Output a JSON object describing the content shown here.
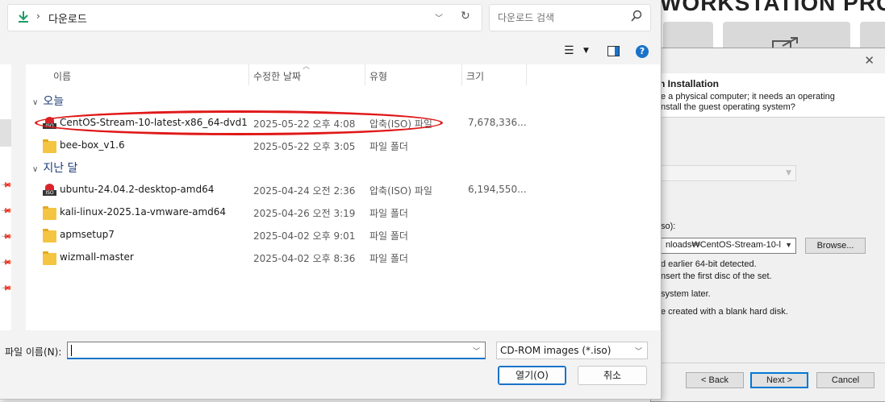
{
  "background_app": {
    "title": "WORKSTATION PRO",
    "wizard": {
      "header_title": "n Installation",
      "header_desc": "e a physical computer; it needs an operating\nnstall the guest operating system?",
      "iso_label": "so):",
      "iso_path": "nloads₩CentOS-Stream-10-l",
      "browse_label": "Browse...",
      "detected_line1": "d earlier 64-bit detected.",
      "detected_line2": "nsert the first disc of the set.",
      "later_line": "system later.",
      "blank_line": "e created with a blank hard disk.",
      "back_label": "< Back",
      "next_label": "Next >",
      "cancel_label": "Cancel"
    }
  },
  "dialog": {
    "breadcrumb": "다운로드",
    "search_placeholder": "다운로드 검색",
    "columns": {
      "name": "이름",
      "date": "수정한 날짜",
      "type": "유형",
      "size": "크기"
    },
    "groups": [
      {
        "label": "오늘",
        "files": [
          {
            "name": "CentOS-Stream-10-latest-x86_64-dvd1",
            "date": "2025-05-22 오후 4:08",
            "type": "압축(ISO) 파일",
            "size": "7,678,336...",
            "icon": "iso"
          },
          {
            "name": "bee-box_v1.6",
            "date": "2025-05-22 오후 3:05",
            "type": "파일 폴더",
            "size": "",
            "icon": "folder"
          }
        ]
      },
      {
        "label": "지난 달",
        "files": [
          {
            "name": "ubuntu-24.04.2-desktop-amd64",
            "date": "2025-04-24 오전 2:36",
            "type": "압축(ISO) 파일",
            "size": "6,194,550...",
            "icon": "iso"
          },
          {
            "name": "kali-linux-2025.1a-vmware-amd64",
            "date": "2025-04-26 오전 3:19",
            "type": "파일 폴더",
            "size": "",
            "icon": "folder"
          },
          {
            "name": "apmsetup7",
            "date": "2025-04-02 오후 9:01",
            "type": "파일 폴더",
            "size": "",
            "icon": "folder"
          },
          {
            "name": "wizmall-master",
            "date": "2025-04-02 오후 8:36",
            "type": "파일 폴더",
            "size": "",
            "icon": "folder"
          }
        ]
      }
    ],
    "filename_label": "파일 이름(N):",
    "filename_value": "",
    "filter_value": "CD-ROM images (*.iso)",
    "open_label": "열기(O)",
    "cancel_label": "취소"
  },
  "colors": {
    "accent": "#1a73c9",
    "highlight": "#e01818",
    "folder": "#f4c542",
    "iso": "#d7262b"
  }
}
